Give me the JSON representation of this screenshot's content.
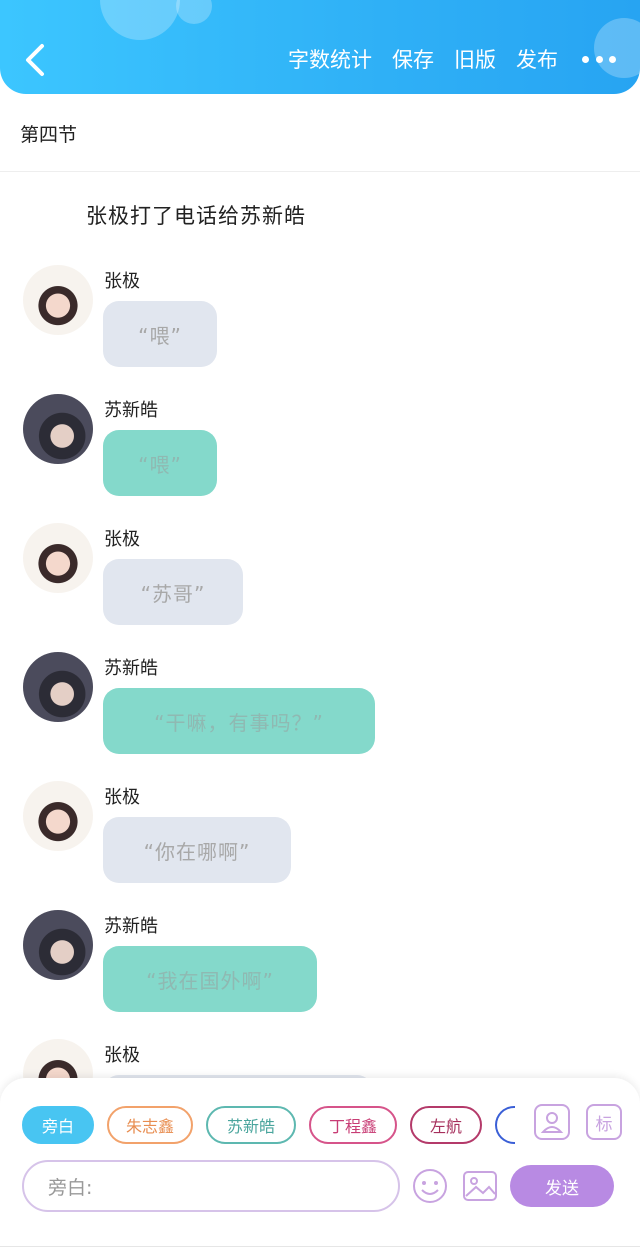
{
  "header": {
    "actions": [
      "字数统计",
      "保存",
      "旧版",
      "发布"
    ]
  },
  "chapter": {
    "title": "第四节"
  },
  "narration": "张极打了电话给苏新皓",
  "messages": [
    {
      "speaker": "张极",
      "text": "“喂”"
    },
    {
      "speaker": "苏新皓",
      "text": "“喂”"
    },
    {
      "speaker": "张极",
      "text": "“苏哥”"
    },
    {
      "speaker": "苏新皓",
      "text": "“干嘛，有事吗？”"
    },
    {
      "speaker": "张极",
      "text": "“你在哪啊”"
    },
    {
      "speaker": "苏新皓",
      "text": "“我在国外啊”"
    },
    {
      "speaker": "张极",
      "text": ""
    }
  ],
  "composer": {
    "roles": [
      "旁白",
      "朱志鑫",
      "苏新皓",
      "丁程鑫",
      "左航"
    ],
    "role_colors": [
      "#48c5f2",
      "#f2a26b",
      "#5db8b0",
      "#d6548a",
      "#b43a6a"
    ],
    "mark_label": "标",
    "input_placeholder": "旁白:",
    "send_label": "发送"
  }
}
